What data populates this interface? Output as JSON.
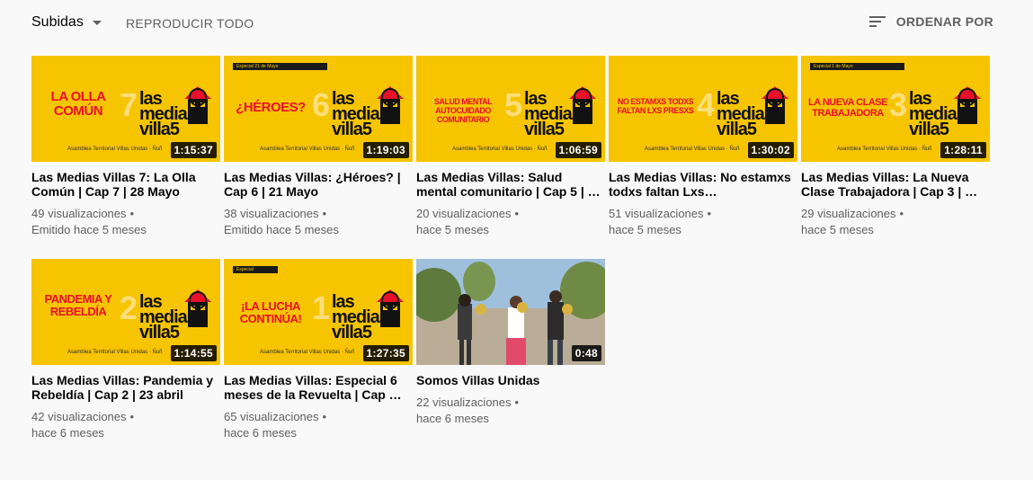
{
  "header": {
    "selector_label": "Subidas",
    "play_all_label": "REPRODUCIR TODO",
    "sort_label": "ORDENAR POR"
  },
  "thumb_common": {
    "logo_top": "las",
    "logo_mid": "medias",
    "logo_bottom": "villa5",
    "footer": "Asamblea Territorial Villas Unidas · Ñuñ"
  },
  "videos": [
    {
      "title": "Las Medias Villas 7: La Olla Común | Cap 7 | 28 Mayo",
      "views": "49 visualizaciones",
      "time": "Emitido hace 5 meses",
      "duration": "1:15:37",
      "thumb_text": "LA OLLA COMÚN",
      "thumb_num": "7",
      "banner": ""
    },
    {
      "title": "Las Medias Villas: ¿Héroes? | Cap 6 | 21 Mayo",
      "views": "38 visualizaciones",
      "time": "Emitido hace 5 meses",
      "duration": "1:19:03",
      "thumb_text": "¿HÉROES?",
      "thumb_num": "6",
      "banner": "Especial 21 de Mayo"
    },
    {
      "title": "Las Medias Villas: Salud mental comunitario | Cap 5 | …",
      "views": "20 visualizaciones",
      "time": "hace 5 meses",
      "duration": "1:06:59",
      "thumb_text": "SALUD MENTAL AUTOCUIDADO COMUNITARIO",
      "thumb_num": "5",
      "banner": ""
    },
    {
      "title": "Las Medias Villas: No estamxs todxs faltan Lxs…",
      "views": "51 visualizaciones",
      "time": "hace 5 meses",
      "duration": "1:30:02",
      "thumb_text": "NO ESTAMXS TODXS FALTAN LXS PRESXS",
      "thumb_num": "4",
      "banner": ""
    },
    {
      "title": "Las Medias Villas: La Nueva Clase Trabajadora | Cap 3 | …",
      "views": "29 visualizaciones",
      "time": "hace 5 meses",
      "duration": "1:28:11",
      "thumb_text": "LA NUEVA CLASE TRABAJADORA",
      "thumb_num": "3",
      "banner": "Especial 1 de Mayo"
    },
    {
      "title": "Las Medias Villas: Pandemia y Rebeldía | Cap 2 | 23 abril",
      "views": "42 visualizaciones",
      "time": "hace 6 meses",
      "duration": "1:14:55",
      "thumb_text": "PANDEMIA Y REBELDÍA",
      "thumb_num": "2",
      "banner": ""
    },
    {
      "title": "Las Medias Villas: Especial 6 meses de la Revuelta | Cap …",
      "views": "65 visualizaciones",
      "time": "hace 6 meses",
      "duration": "1:27:35",
      "thumb_text": "¡LA LUCHA CONTINÚA!",
      "thumb_num": "1",
      "banner": "Especial"
    },
    {
      "title": "Somos Villas Unidas",
      "views": "22 visualizaciones",
      "time": "hace 6 meses",
      "duration": "0:48",
      "thumb_text": "",
      "thumb_num": "",
      "banner": ""
    }
  ]
}
